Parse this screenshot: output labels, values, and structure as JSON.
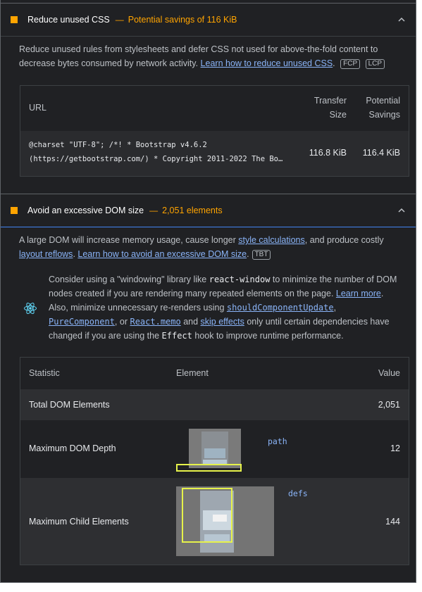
{
  "audit_css": {
    "title": "Reduce unused CSS",
    "separator": "—",
    "display_value": "Potential savings of 116 KiB",
    "description": "Reduce unused rules from stylesheets and defer CSS not used for above-the-fold content to decrease bytes consumed by network activity.",
    "learn_link": "Learn how to reduce unused CSS",
    "badges": [
      "FCP",
      "LCP"
    ],
    "table": {
      "headers": {
        "url": "URL",
        "transfer_1": "Transfer",
        "transfer_2": "Size",
        "savings_1": "Potential",
        "savings_2": "Savings"
      },
      "rows": [
        {
          "url_line1": "@charset \"UTF-8\"; /*! * Bootstrap v4.6.2",
          "url_line2": "(https://getbootstrap.com/) * Copyright 2011-2022 The Bo…",
          "transfer": "116.8 KiB",
          "savings": "116.4 KiB"
        }
      ]
    }
  },
  "audit_dom": {
    "title": "Avoid an excessive DOM size",
    "separator": "—",
    "display_value": "2,051 elements",
    "desc_1": "A large DOM will increase memory usage, cause longer ",
    "link_style": "style calculations",
    "desc_2": ", and produce costly ",
    "link_layout": "layout reflows",
    "desc_3": ". ",
    "learn_link": "Learn how to avoid an excessive DOM size",
    "badge": "TBT",
    "stack_pack": {
      "icon": "react-icon",
      "t1": "Consider using a \"windowing\" library like ",
      "c1": "react-window",
      "t2": " to minimize the number of DOM nodes created if you are rendering many repeated elements on the page. ",
      "l1": "Learn more",
      "t3": ". Also, minimize unnecessary re-renders using ",
      "l2": "shouldComponentUpdate",
      "t4": ", ",
      "l3": "PureComponent",
      "t5": ", or ",
      "l4": "React.memo",
      "t6": " and ",
      "l5": "skip effects",
      "t7": " only until certain dependencies have changed if you are using the ",
      "c2": "Effect",
      "t8": " hook to improve runtime performance."
    },
    "table": {
      "headers": {
        "statistic": "Statistic",
        "element": "Element",
        "value": "Value"
      },
      "rows": [
        {
          "statistic": "Total DOM Elements",
          "element": "",
          "value": "2,051"
        },
        {
          "statistic": "Maximum DOM Depth",
          "element": "path",
          "value": "12"
        },
        {
          "statistic": "Maximum Child Elements",
          "element": "defs",
          "value": "144"
        }
      ]
    }
  },
  "colors": {
    "bg": "#202124",
    "warn": "#ffa400",
    "link": "#8ab4f8",
    "text": "#e8eaed"
  }
}
